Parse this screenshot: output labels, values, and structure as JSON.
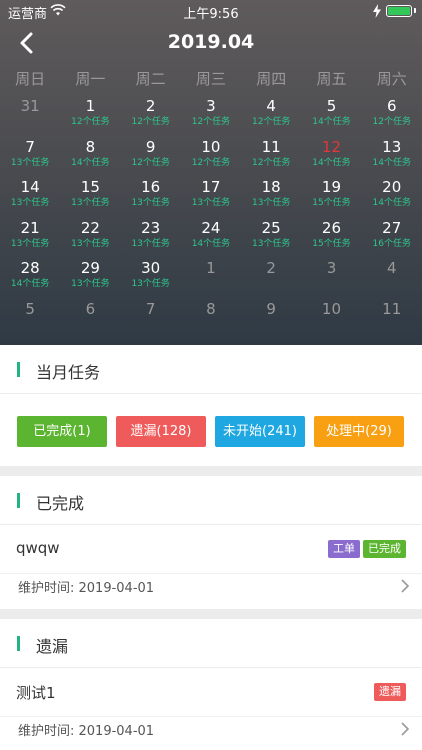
{
  "status_bar": {
    "carrier": "运营商",
    "time": "上午9:56",
    "battery_color": "#34c759"
  },
  "header": {
    "title": "2019.04",
    "back_icon": "chevron-left-icon"
  },
  "calendar": {
    "weekdays": [
      "周日",
      "周一",
      "周二",
      "周三",
      "周四",
      "周五",
      "周六"
    ],
    "weeks": [
      [
        {
          "d": "31",
          "t": "",
          "m": true
        },
        {
          "d": "1",
          "t": "12个任务"
        },
        {
          "d": "2",
          "t": "12个任务"
        },
        {
          "d": "3",
          "t": "12个任务"
        },
        {
          "d": "4",
          "t": "12个任务"
        },
        {
          "d": "5",
          "t": "14个任务"
        },
        {
          "d": "6",
          "t": "12个任务"
        }
      ],
      [
        {
          "d": "7",
          "t": "13个任务"
        },
        {
          "d": "8",
          "t": "14个任务"
        },
        {
          "d": "9",
          "t": "12个任务"
        },
        {
          "d": "10",
          "t": "12个任务"
        },
        {
          "d": "11",
          "t": "12个任务"
        },
        {
          "d": "12",
          "t": "14个任务",
          "today": true
        },
        {
          "d": "13",
          "t": "14个任务"
        }
      ],
      [
        {
          "d": "14",
          "t": "13个任务"
        },
        {
          "d": "15",
          "t": "13个任务"
        },
        {
          "d": "16",
          "t": "13个任务"
        },
        {
          "d": "17",
          "t": "13个任务"
        },
        {
          "d": "18",
          "t": "13个任务"
        },
        {
          "d": "19",
          "t": "15个任务"
        },
        {
          "d": "20",
          "t": "14个任务"
        }
      ],
      [
        {
          "d": "21",
          "t": "13个任务"
        },
        {
          "d": "22",
          "t": "13个任务"
        },
        {
          "d": "23",
          "t": "13个任务"
        },
        {
          "d": "24",
          "t": "14个任务"
        },
        {
          "d": "25",
          "t": "13个任务"
        },
        {
          "d": "26",
          "t": "15个任务"
        },
        {
          "d": "27",
          "t": "16个任务"
        }
      ],
      [
        {
          "d": "28",
          "t": "14个任务"
        },
        {
          "d": "29",
          "t": "13个任务"
        },
        {
          "d": "30",
          "t": "13个任务"
        },
        {
          "d": "1",
          "t": "",
          "m": true
        },
        {
          "d": "2",
          "t": "",
          "m": true
        },
        {
          "d": "3",
          "t": "",
          "m": true
        },
        {
          "d": "4",
          "t": "",
          "m": true
        }
      ],
      [
        {
          "d": "5",
          "t": "",
          "m": true
        },
        {
          "d": "6",
          "t": "",
          "m": true
        },
        {
          "d": "7",
          "t": "",
          "m": true
        },
        {
          "d": "8",
          "t": "",
          "m": true
        },
        {
          "d": "9",
          "t": "",
          "m": true
        },
        {
          "d": "10",
          "t": "",
          "m": true
        },
        {
          "d": "11",
          "t": "",
          "m": true
        }
      ]
    ],
    "task_color": "#2dc58c",
    "today_color": "#e0363c"
  },
  "month_tasks": {
    "title": "当月任务",
    "buttons": [
      {
        "label": "已完成(1)",
        "color": "#5cb531"
      },
      {
        "label": "遗漏(128)",
        "color": "#ef5b5b"
      },
      {
        "label": "未开始(241)",
        "color": "#1ea7e1"
      },
      {
        "label": "处理中(29)",
        "color": "#f89f12"
      }
    ]
  },
  "completed_section": {
    "title": "已完成",
    "item": {
      "name": "qwqw",
      "badges": [
        {
          "label": "工单",
          "color": "#8a6bce"
        },
        {
          "label": "已完成",
          "color": "#5cb531"
        }
      ],
      "time_label": "维护时间: 2019-04-01"
    }
  },
  "missed_section": {
    "title": "遗漏",
    "item": {
      "name": "测试1",
      "badges": [
        {
          "label": "遗漏",
          "color": "#ef5b5b"
        }
      ],
      "time_label": "维护时间: 2019-04-01"
    }
  },
  "accent_color": "#24b383"
}
